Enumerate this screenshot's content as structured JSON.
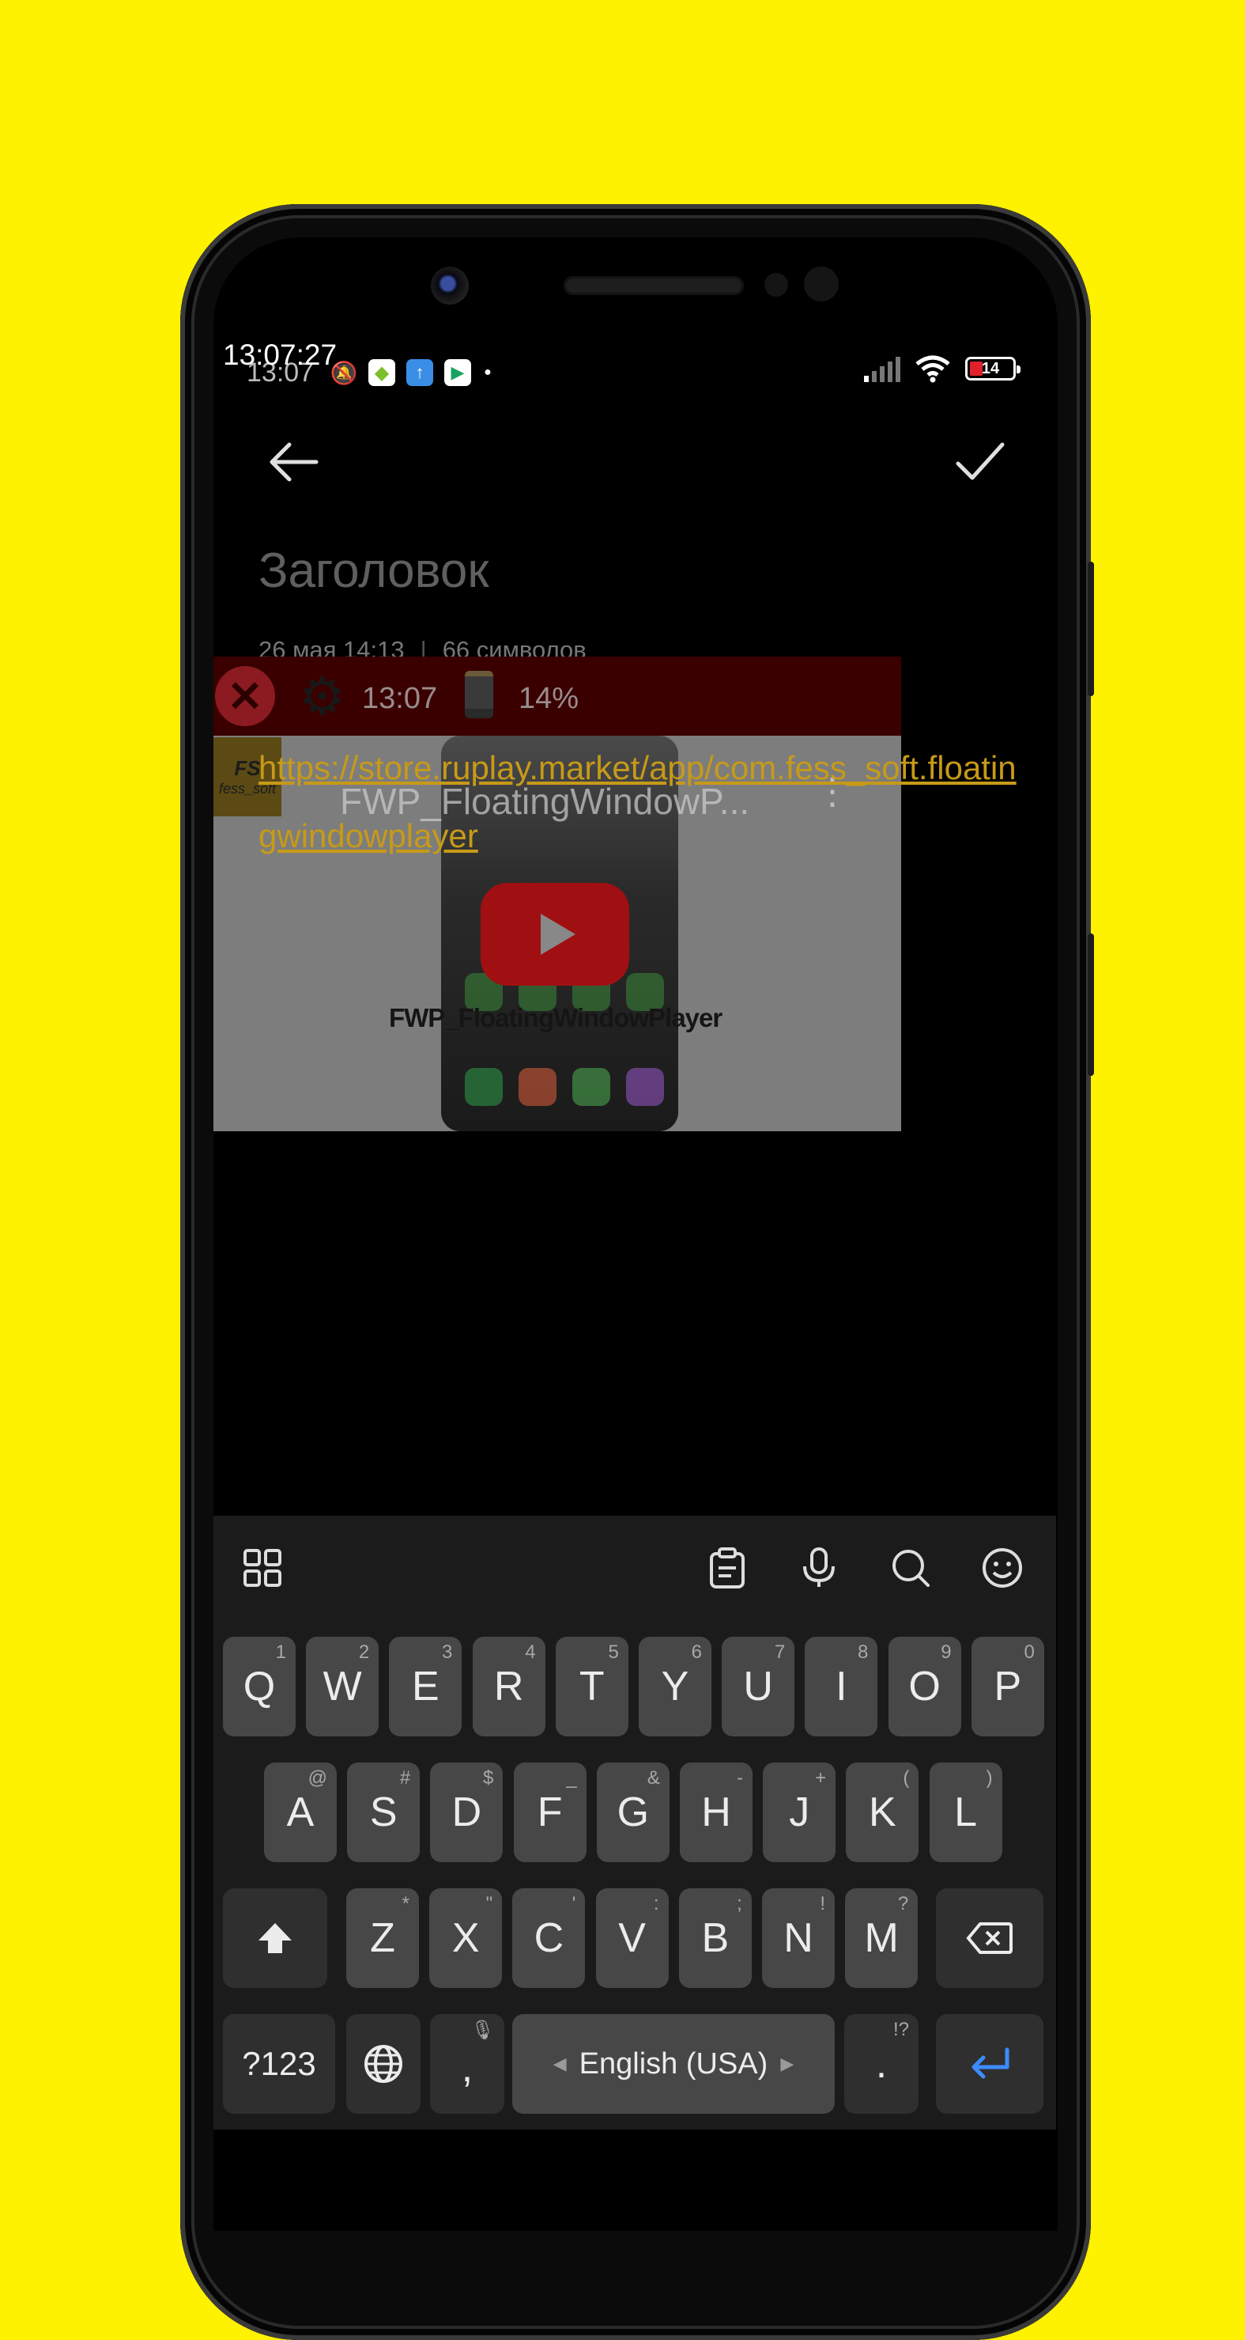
{
  "status_bar": {
    "time_overlay": "13:07:27",
    "time": "13:07",
    "battery_level": "14",
    "notification_icons": [
      "mute-icon",
      "android-app-icon",
      "upload-icon",
      "play-store-icon",
      "dot-icon"
    ]
  },
  "note": {
    "title_placeholder": "Заголовок",
    "date": "26 мая  14:13",
    "separator": "|",
    "char_count": "66 символов",
    "body_link": "https://store.ruplay.market/app/com.fess_soft.floatingwindowplayer"
  },
  "floating_window": {
    "time": "13:07",
    "battery_percent": "14%",
    "video_title": "FWP_FloatingWindowP...",
    "video_caption": "FWP_FloatingWindowPlayer",
    "logo_initials": "FS",
    "logo_text": "fess_soft"
  },
  "keyboard": {
    "row1": [
      {
        "k": "Q",
        "h": "1"
      },
      {
        "k": "W",
        "h": "2"
      },
      {
        "k": "E",
        "h": "3"
      },
      {
        "k": "R",
        "h": "4"
      },
      {
        "k": "T",
        "h": "5"
      },
      {
        "k": "Y",
        "h": "6"
      },
      {
        "k": "U",
        "h": "7"
      },
      {
        "k": "I",
        "h": "8"
      },
      {
        "k": "O",
        "h": "9"
      },
      {
        "k": "P",
        "h": "0"
      }
    ],
    "row2": [
      {
        "k": "A",
        "h": "@"
      },
      {
        "k": "S",
        "h": "#"
      },
      {
        "k": "D",
        "h": "$"
      },
      {
        "k": "F",
        "h": "_"
      },
      {
        "k": "G",
        "h": "&"
      },
      {
        "k": "H",
        "h": "-"
      },
      {
        "k": "J",
        "h": "+"
      },
      {
        "k": "K",
        "h": "("
      },
      {
        "k": "L",
        "h": ")"
      }
    ],
    "row3": [
      {
        "k": "Z",
        "h": "*"
      },
      {
        "k": "X",
        "h": "\""
      },
      {
        "k": "C",
        "h": "'"
      },
      {
        "k": "V",
        "h": ":"
      },
      {
        "k": "B",
        "h": ";"
      },
      {
        "k": "N",
        "h": "!"
      },
      {
        "k": "M",
        "h": "?"
      }
    ],
    "symbols_key": "?123",
    "comma_key": ",",
    "space_label": "English (USA)",
    "period_key": ".",
    "period_hint": "!?",
    "colors": {
      "enter_arrow": "#3d8bff",
      "key_bg": "#474747",
      "func_key_bg": "#2f2f2f"
    }
  }
}
